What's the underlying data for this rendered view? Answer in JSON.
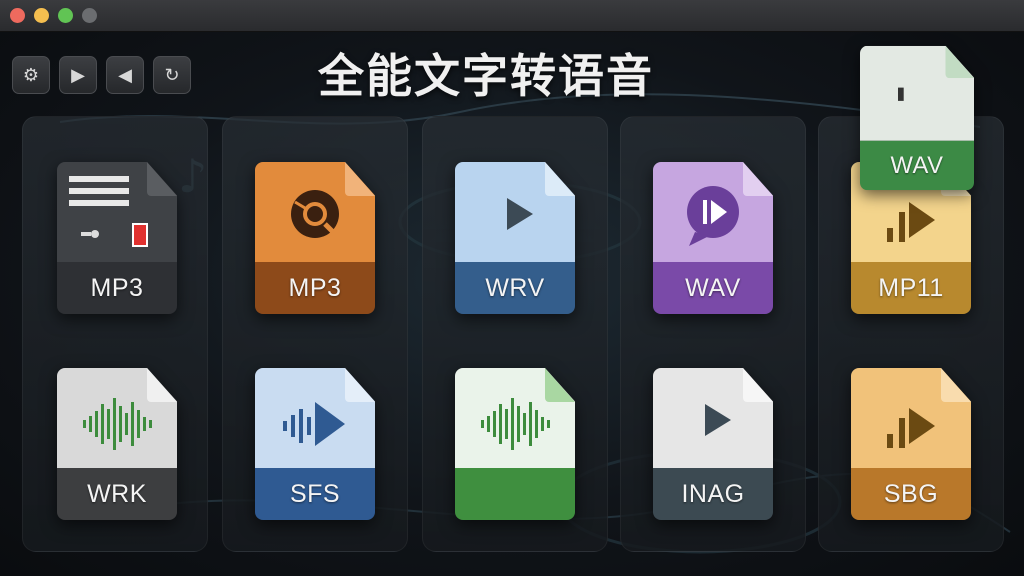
{
  "window": {
    "traffic_lights": [
      "#ee6a5e",
      "#f4be4f",
      "#61c454",
      "#6b6d70"
    ]
  },
  "toolbar": {
    "buttons": [
      {
        "icon": "settings-gear-icon",
        "glyph": "⚙"
      },
      {
        "icon": "play-icon",
        "glyph": "▶"
      },
      {
        "icon": "rewind-icon",
        "glyph": "◀"
      },
      {
        "icon": "refresh-icon",
        "glyph": "↻"
      }
    ]
  },
  "app": {
    "title": "全能文字转语音"
  },
  "files": [
    {
      "label": "MP3",
      "icon": "audio-device-icon",
      "top": "#3f4246",
      "band": "#2e3034",
      "fold": "#5a5d61"
    },
    {
      "label": "MP3",
      "icon": "podcast-mic-icon",
      "top": "#e28b3c",
      "band": "#8d4a1a",
      "fold": "#f1b37a"
    },
    {
      "label": "WRV",
      "icon": "play-icon",
      "top": "#b9d4ef",
      "band": "#345e8c",
      "fold": "#dcebf8"
    },
    {
      "label": "WAV",
      "icon": "chat-play-icon",
      "top": "#c6a6e0",
      "band": "#7a4aa8",
      "fold": "#e2cff0"
    },
    {
      "label": "MP11",
      "icon": "sound-waves-icon",
      "top": "#f3d48c",
      "band": "#b8892e",
      "fold": "#fbe9bd"
    },
    {
      "label": "WRK",
      "icon": "waveform-icon",
      "top": "#d9d9d9",
      "band": "#3d3e40",
      "fold": "#f0f0f0"
    },
    {
      "label": "SFS",
      "icon": "waveform-play-icon",
      "top": "#c9dcf1",
      "band": "#2f5a92",
      "fold": "#e4eef9"
    },
    {
      "label": "",
      "icon": "waveform-icon",
      "top": "#eaf3ea",
      "band": "#3f8f3f",
      "fold": "#a9d7a2"
    },
    {
      "label": "INAG",
      "icon": "play-icon",
      "top": "#e6e6e6",
      "band": "#3c4a52",
      "fold": "#f6f6f6"
    },
    {
      "label": "SBG",
      "icon": "sound-waves-icon",
      "top": "#f1c27a",
      "band": "#b9782a",
      "fold": "#f9dcae"
    }
  ],
  "floating_file": {
    "label": "WAV",
    "icon": "file-icon",
    "top": "#e3e9e3",
    "band": "#3c8a45",
    "fold": "#c2dcc3"
  }
}
